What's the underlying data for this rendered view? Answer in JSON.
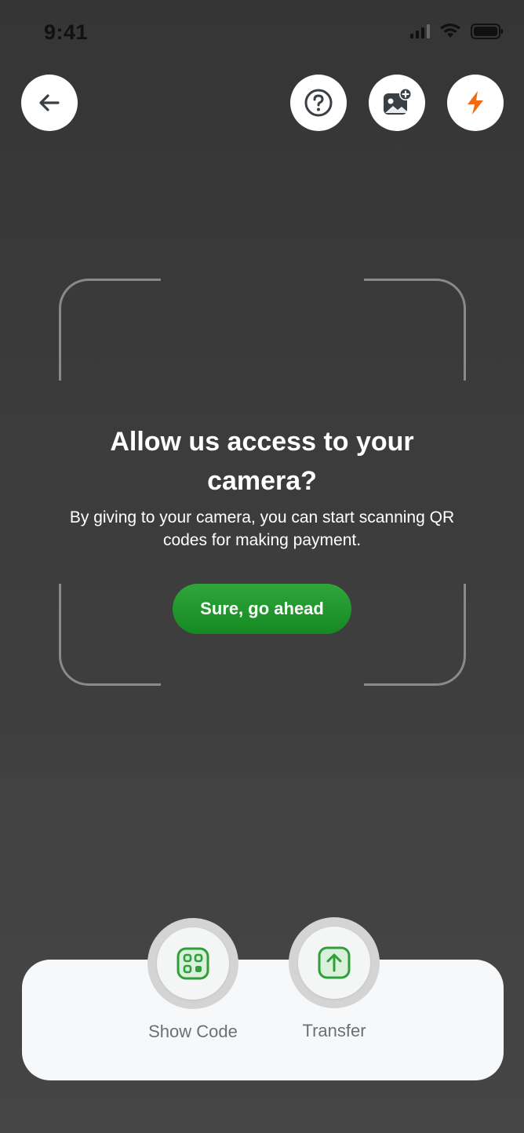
{
  "status_bar": {
    "time": "9:41"
  },
  "header": {
    "back_icon": "arrow-left-icon",
    "help_icon": "question-circle-icon",
    "gallery_icon": "image-plus-icon",
    "flash_icon": "lightning-icon"
  },
  "permission_prompt": {
    "title": "Allow us access to your camera?",
    "description": "By giving to your camera, you can start scanning QR codes for making payment.",
    "button_label": "Sure, go ahead"
  },
  "bottom_actions": [
    {
      "label": "Show Code",
      "icon": "qr-grid-icon"
    },
    {
      "label": "Transfer",
      "icon": "upload-arrow-icon"
    }
  ],
  "colors": {
    "accent_green": "#1f9a2c",
    "flash_orange": "#f26a10",
    "icon_dark": "#3a3f45"
  }
}
